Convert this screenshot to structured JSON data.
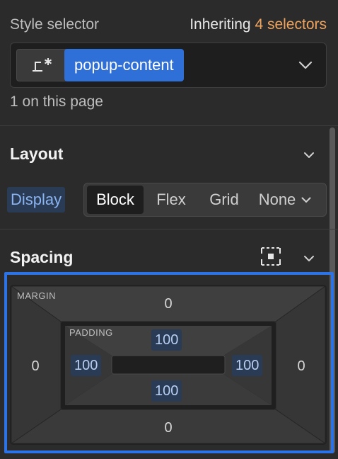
{
  "selector": {
    "title": "Style selector",
    "inherit_prefix": "Inheriting ",
    "inherit_count": "4 selectors",
    "tag": "popup-content",
    "on_page": "1 on this page"
  },
  "layout": {
    "title": "Layout",
    "display_label": "Display",
    "options": [
      "Block",
      "Flex",
      "Grid",
      "None"
    ],
    "selected": "Block"
  },
  "spacing": {
    "title": "Spacing",
    "margin_label": "MARGIN",
    "padding_label": "PADDING",
    "margin": {
      "top": "0",
      "right": "0",
      "bottom": "0",
      "left": "0"
    },
    "padding": {
      "top": "100",
      "right": "100",
      "bottom": "100",
      "left": "100"
    }
  },
  "colors": {
    "accent": "#2f6fd8",
    "focus": "#2b73e6",
    "inherit": "#f0a35c"
  }
}
